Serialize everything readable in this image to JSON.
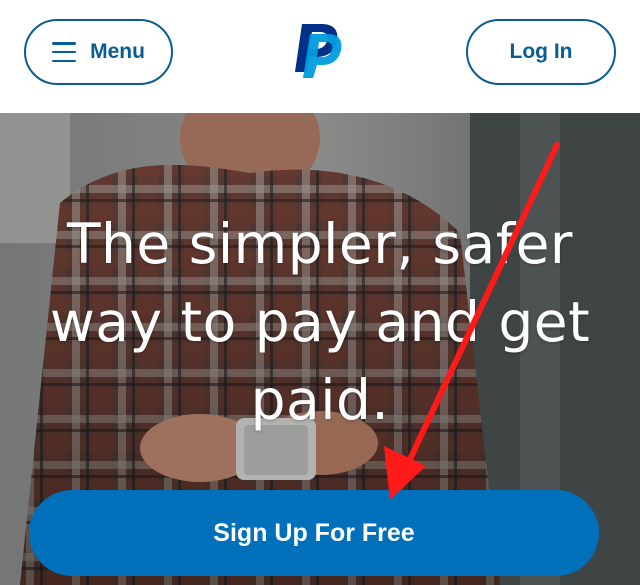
{
  "header": {
    "menu_label": "Menu",
    "login_label": "Log In",
    "logo_icon": "paypal-logo"
  },
  "hero": {
    "headline": "The simpler, safer way to pay and get paid.",
    "signup_label": "Sign Up For Free"
  },
  "colors": {
    "brand_blue": "#0070ba",
    "brand_navy": "#003087",
    "brand_light": "#009cde",
    "border_blue": "#0a5d94",
    "annotation_red": "#ff1a1a"
  }
}
